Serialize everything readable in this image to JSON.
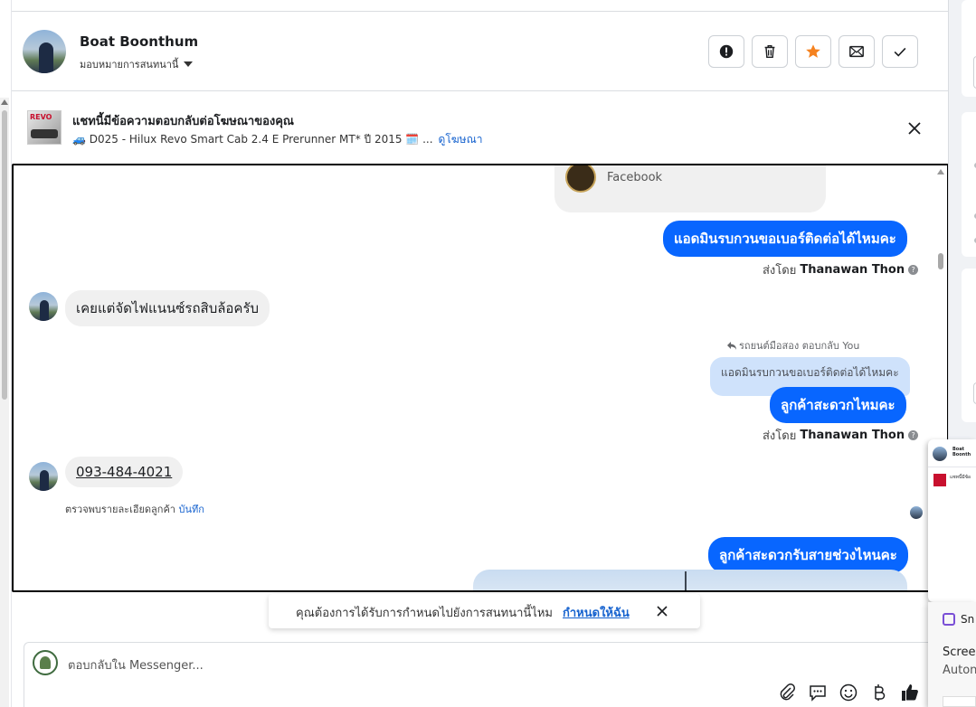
{
  "header": {
    "contact_name": "Boat Boonthum",
    "assign_label": "มอบหมายการสนทนานี้"
  },
  "ad": {
    "thumb_text": "REVO",
    "title": "แชทนี้มีข้อความตอบกลับต่อโฆษณาของคุณ",
    "subtitle": "🚙 D025 - Hilux Revo Smart Cab 2.4 E Prerunner MT* ปี 2015 🗓️ ...",
    "link": "ดูโฆษณา"
  },
  "messages": {
    "card_source": "Facebook",
    "m1": "แอดมินรบกวนขอเบอร์ติดต่อได้ไหมคะ",
    "sent_by_prefix": "ส่งโดย",
    "sent_by_name": "Thanawan Thon",
    "m2": "เคยแต่จัดไฟแนนซ์รถสิบล้อครับ",
    "reply_label": "รถยนต์มือสอง ตอบกลับ You",
    "reply_quote": "แอดมินรบกวนขอเบอร์ติดต่อได้ไหมคะ",
    "m3": "ลูกค้าสะดวกไหมคะ",
    "m4": "093-484-4021",
    "detect_text": "ตรวจพบรายละเอียดลูกค้า",
    "detect_link": "บันทึก",
    "m5": "ลูกค้าสะดวกรับสายช่วงไหนคะ"
  },
  "assign_banner": {
    "text": "คุณต้องการได้รับการกำหนดไปยังการสนทนานี้ไหม",
    "link": "กำหนดให้ฉัน"
  },
  "composer": {
    "placeholder": "ตอบกลับใน Messenger..."
  },
  "mini_window": {
    "name": "Boat Boonth",
    "preview": "แชทนี้มีข้อ"
  },
  "snip": {
    "title": "Sn",
    "line1": "Screen",
    "line2": "Auton"
  },
  "colors": {
    "accent": "#0866ff",
    "link": "#1763cf",
    "star": "#f5821f"
  }
}
